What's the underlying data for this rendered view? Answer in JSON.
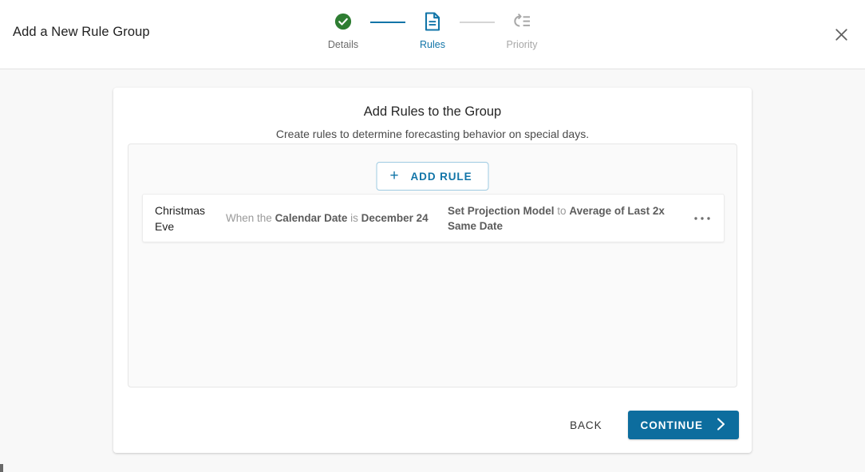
{
  "header": {
    "title": "Add a New Rule Group",
    "close_icon": "close-icon"
  },
  "stepper": {
    "steps": [
      {
        "label": "Details",
        "state": "done",
        "icon": "check-circle-icon"
      },
      {
        "label": "Rules",
        "state": "active",
        "icon": "document-icon"
      },
      {
        "label": "Priority",
        "state": "todo",
        "icon": "reorder-priority-icon"
      }
    ],
    "colors": {
      "done": "#2e7d32",
      "active": "#1275a8",
      "todo": "#a8a8a8",
      "connector_filled": "#1275a8",
      "connector_empty": "#d5d5d5"
    }
  },
  "card": {
    "title": "Add Rules to the Group",
    "subtitle": "Create rules to determine forecasting behavior on special days."
  },
  "rules_panel": {
    "add_rule_label": "ADD RULE",
    "add_rule_icon": "plus-icon",
    "rules": [
      {
        "name": "Christmas Eve",
        "condition": {
          "prefix": "When the",
          "field": "Calendar Date",
          "operator": "is",
          "value": "December 24"
        },
        "action": {
          "subject": "Set Projection Model",
          "connector": "to",
          "value": "Average of Last 2x Same Date"
        },
        "menu_icon": "ellipsis-horizontal-icon"
      }
    ]
  },
  "footer": {
    "back_label": "BACK",
    "continue_label": "CONTINUE",
    "continue_icon": "chevron-right-icon",
    "continue_color": "#0d6d9e"
  }
}
